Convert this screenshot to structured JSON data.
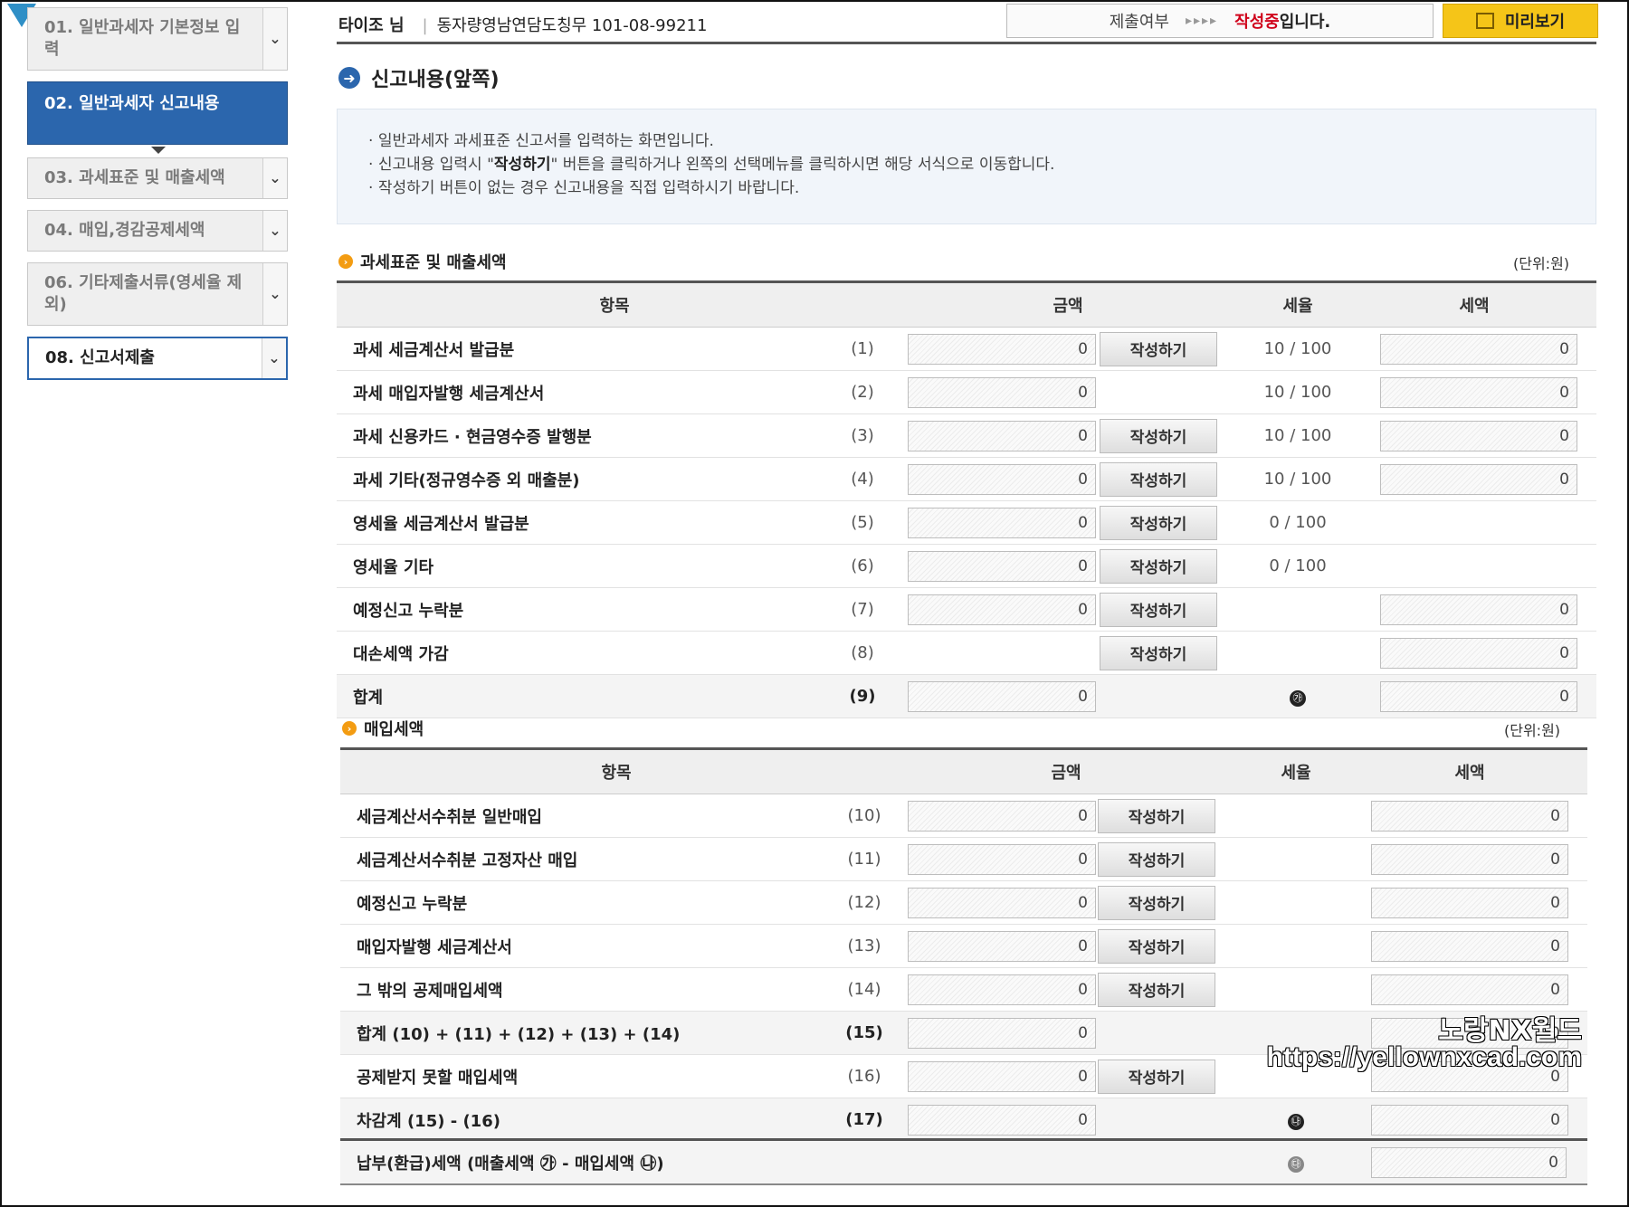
{
  "sidebar": {
    "items": [
      {
        "label": "01. 일반과세자 기본정보 입력"
      },
      {
        "label": "02. 일반과세자 신고내용"
      },
      {
        "label": "03. 과세표준 및 매출세액"
      },
      {
        "label": "04. 매입,경감공제세액"
      },
      {
        "label": "06. 기타제출서류(영세율 제외)"
      },
      {
        "label": "08. 신고서제출"
      }
    ]
  },
  "header": {
    "user_name": "타이조 님",
    "company": "동자량영남연담도칭무 101-08-99211",
    "status_label": "제출여부",
    "status_arrows": "▸▸▸▸",
    "status_value": "작성중",
    "status_suffix": "입니다.",
    "preview_label": "미리보기"
  },
  "section": {
    "title": "신고내용(앞쪽)"
  },
  "info": {
    "line1": "일반과세자 과세표준 신고서를 입력하는 화면입니다.",
    "line2_pre": "신고내용 입력시 \"",
    "line2_bold": "작성하기",
    "line2_post": "\" 버튼을 클릭하거나 왼쪽의 선택메뉴를 클릭하시면 해당 서식으로 이동합니다.",
    "line3": "작성하기 버튼이 없는 경우 신고내용을 직접 입력하시기 바랍니다."
  },
  "sales": {
    "heading": "과세표준 및 매출세액",
    "unit": "(단위:원)",
    "headers": {
      "item": "항목",
      "amount": "금액",
      "rate": "세율",
      "tax": "세액"
    },
    "write_label": "작성하기",
    "rows": [
      {
        "label": "과세 세금계산서 발급분",
        "num": "(1)",
        "amount": "0",
        "rate": "10 / 100",
        "tax": "0"
      },
      {
        "label": "과세 매입자발행 세금계산서",
        "num": "(2)",
        "amount": "0",
        "rate": "10 / 100",
        "tax": "0"
      },
      {
        "label": "과세 신용카드 · 현금영수증 발행분",
        "num": "(3)",
        "amount": "0",
        "rate": "10 / 100",
        "tax": "0"
      },
      {
        "label": "과세 기타(정규영수증 외 매출분)",
        "num": "(4)",
        "amount": "0",
        "rate": "10 / 100",
        "tax": "0"
      },
      {
        "label": "영세율 세금계산서 발급분",
        "num": "(5)",
        "amount": "0",
        "rate": "0 / 100",
        "tax": ""
      },
      {
        "label": "영세율 기타",
        "num": "(6)",
        "amount": "0",
        "rate": "0 / 100",
        "tax": ""
      },
      {
        "label": "예정신고 누락분",
        "num": "(7)",
        "amount": "0",
        "rate": "",
        "tax": "0"
      },
      {
        "label": "대손세액 가감",
        "num": "(8)",
        "amount": "",
        "rate": "",
        "tax": "0"
      },
      {
        "label": "합계",
        "num": "(9)",
        "amount": "0",
        "rate": "㉮",
        "tax": "0"
      }
    ]
  },
  "purchase": {
    "heading": "매입세액",
    "unit": "(단위:원)",
    "headers": {
      "item": "항목",
      "amount": "금액",
      "rate": "세율",
      "tax": "세액"
    },
    "write_label": "작성하기",
    "rows": [
      {
        "label": "세금계산서수취분 일반매입",
        "num": "(10)",
        "amount": "0",
        "tax": "0"
      },
      {
        "label": "세금계산서수취분 고정자산 매입",
        "num": "(11)",
        "amount": "0",
        "tax": "0"
      },
      {
        "label": "예정신고 누락분",
        "num": "(12)",
        "amount": "0",
        "tax": "0"
      },
      {
        "label": "매입자발행 세금계산서",
        "num": "(13)",
        "amount": "0",
        "tax": "0"
      },
      {
        "label": "그 밖의 공제매입세액",
        "num": "(14)",
        "amount": "0",
        "tax": "0"
      },
      {
        "label": "합계 (10) + (11) + (12) + (13) + (14)",
        "num": "(15)",
        "amount": "0",
        "tax": "0"
      },
      {
        "label": "공제받지 못할 매입세액",
        "num": "(16)",
        "amount": "0",
        "tax": "0"
      },
      {
        "label": "차감계 (15) - (16)",
        "num": "(17)",
        "amount": "0",
        "mark": "㉯",
        "tax": "0"
      }
    ]
  },
  "payment": {
    "label": "납부(환급)세액 (매출세액 ㉮ - 매입세액 ㉯)",
    "mark": "㉰",
    "tax": "0"
  },
  "watermark": {
    "line1": "노랑NX월드",
    "line2": "https://yellownxcad.com"
  }
}
